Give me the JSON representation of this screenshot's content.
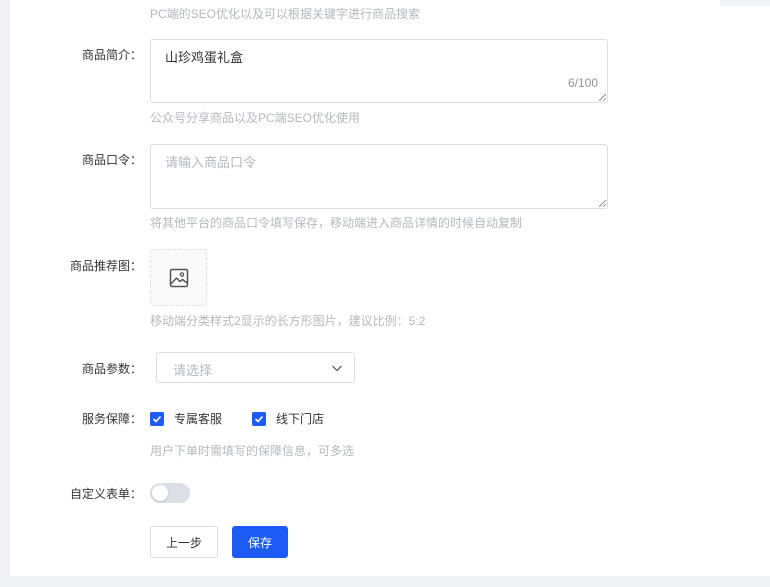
{
  "seo_tip": "PC端的SEO优化以及可以根据关键字进行商品搜索",
  "intro": {
    "label": "商品简介：",
    "value": "山珍鸡蛋礼盒",
    "count": "6/100",
    "tip": "公众号分享商品以及PC端SEO优化使用"
  },
  "command": {
    "label": "商品口令：",
    "placeholder": "请输入商品口令",
    "tip": "将其他平台的商品口令填写保存，移动端进入商品详情的时候自动复制"
  },
  "recommend": {
    "label": "商品推荐图：",
    "icon": "image-icon",
    "tip": "移动端分类样式2显示的长方形图片，建议比例：5:2"
  },
  "params": {
    "label": "商品参数：",
    "placeholder": "请选择"
  },
  "service": {
    "label": "服务保障：",
    "options": [
      {
        "label": "专属客服",
        "checked": true
      },
      {
        "label": "线下门店",
        "checked": true
      }
    ],
    "tip": "用户下单时需填写的保障信息，可多选"
  },
  "custom_form": {
    "label": "自定义表单：",
    "enabled": false
  },
  "buttons": {
    "prev": "上一步",
    "save": "保存"
  },
  "colors": {
    "primary": "#1e5af5",
    "tip": "#b5b8bf",
    "border": "#dcdfe6",
    "background": "#f0f2f5"
  }
}
